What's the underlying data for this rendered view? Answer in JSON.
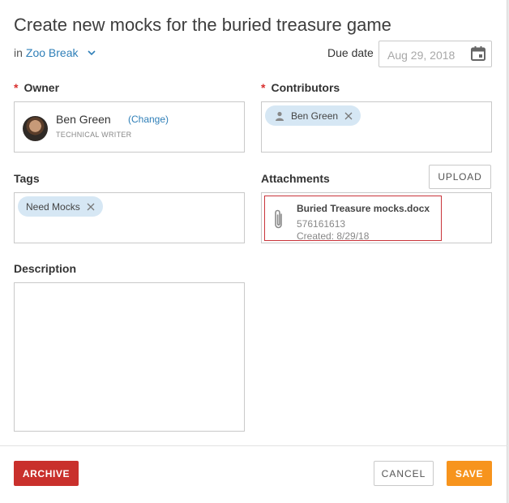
{
  "dialog": {
    "title": "Create new mocks for the buried treasure game",
    "project_prefix": "in",
    "project_name": "Zoo Break"
  },
  "due_date": {
    "label": "Due date",
    "placeholder": "Aug 29, 2018"
  },
  "owner": {
    "label": "Owner",
    "required_mark": "*",
    "name": "Ben Green",
    "change_label": "(Change)",
    "role": "TECHNICAL WRITER"
  },
  "contributors": {
    "label": "Contributors",
    "required_mark": "*",
    "chips": [
      {
        "label": "Ben Green"
      }
    ]
  },
  "tags": {
    "label": "Tags",
    "chips": [
      {
        "label": "Need Mocks"
      }
    ]
  },
  "attachments": {
    "label": "Attachments",
    "upload_label": "UPLOAD",
    "items": [
      {
        "name": "Buried Treasure mocks.docx",
        "size": "576161613",
        "created": "Created: 8/29/18"
      }
    ]
  },
  "description": {
    "label": "Description",
    "value": ""
  },
  "footer": {
    "archive_label": "ARCHIVE",
    "cancel_label": "CANCEL",
    "save_label": "SAVE"
  },
  "colors": {
    "link": "#2f7fb8",
    "required": "#d9302e",
    "archive": "#c9302c",
    "save": "#f7941d",
    "chip": "#d6e7f4",
    "attachment_border": "#c9343a"
  },
  "icons": {
    "project_dropdown": "chevron-down-icon",
    "due_date": "calendar-icon",
    "contributor_chip": "person-icon",
    "chip_remove": "close-icon",
    "attachment": "paperclip-icon"
  }
}
